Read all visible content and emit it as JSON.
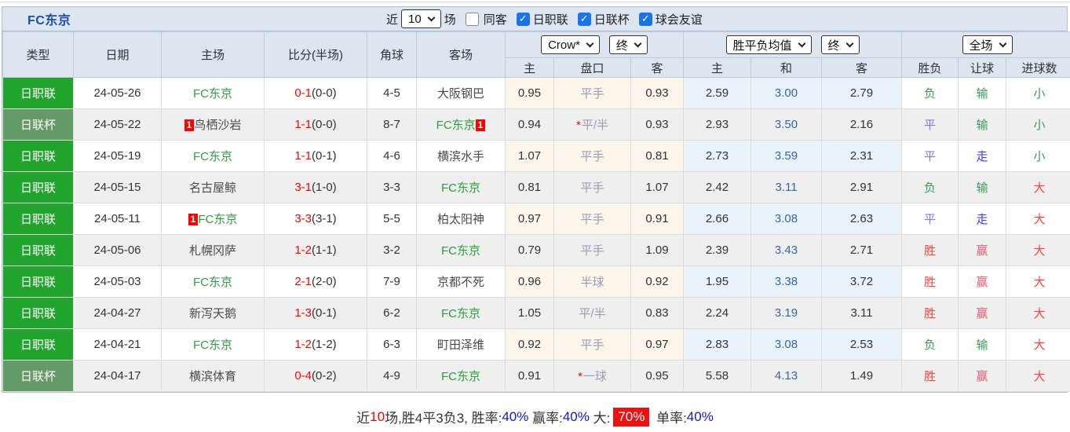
{
  "header": {
    "title": "FC东京"
  },
  "controls": {
    "recent_label": "近",
    "recent_value": "10",
    "matches_label": "场",
    "filters": [
      {
        "label": "同客",
        "checked": false
      },
      {
        "label": "日职联",
        "checked": true
      },
      {
        "label": "日联杯",
        "checked": true
      },
      {
        "label": "球会友谊",
        "checked": true
      }
    ]
  },
  "table": {
    "dropdowns": {
      "crow_company": "Crow*",
      "crow_period": "终",
      "avg_name": "胜平负均值",
      "avg_period": "终",
      "scope": "全场"
    },
    "columns": {
      "type": "类型",
      "date": "日期",
      "home": "主场",
      "score": "比分(半场)",
      "corner": "角球",
      "away": "客场",
      "sub": [
        "主",
        "盘口",
        "客",
        "主",
        "和",
        "客",
        "胜负",
        "让球",
        "进球数"
      ]
    },
    "rows": [
      {
        "league": "日职联",
        "league_type": "league",
        "date": "24-05-26",
        "home": {
          "name": "FC东京",
          "is_fc": true
        },
        "score_ft": "0-1",
        "score_ht": "0-0",
        "corner": "4-5",
        "away": {
          "name": "大阪钢巴",
          "is_fc": false
        },
        "crow_home": "0.95",
        "handicap": {
          "star": false,
          "text": "平手"
        },
        "crow_away": "0.93",
        "avg_home": "2.59",
        "avg_draw": "3.00",
        "avg_away": "2.79",
        "result": {
          "text": "负",
          "color": "green"
        },
        "handicap_result": {
          "text": "输",
          "color": "green"
        },
        "goals": {
          "text": "小",
          "color": "green"
        }
      },
      {
        "league": "日联杯",
        "league_type": "cup",
        "date": "24-05-22",
        "home": {
          "name": "鸟栖沙岩",
          "is_fc": false,
          "badge_before": "1"
        },
        "score_ft": "1-1",
        "score_ht": "0-0",
        "corner": "8-7",
        "away": {
          "name": "FC东京",
          "is_fc": true,
          "badge_after": "1"
        },
        "crow_home": "0.94",
        "handicap": {
          "star": true,
          "text": "平/半"
        },
        "crow_away": "0.93",
        "avg_home": "2.93",
        "avg_draw": "3.50",
        "avg_away": "2.16",
        "result": {
          "text": "平",
          "color": "blue"
        },
        "handicap_result": {
          "text": "输",
          "color": "green"
        },
        "goals": {
          "text": "小",
          "color": "green"
        }
      },
      {
        "league": "日职联",
        "league_type": "league",
        "date": "24-05-19",
        "home": {
          "name": "FC东京",
          "is_fc": true
        },
        "score_ft": "1-1",
        "score_ht": "0-1",
        "corner": "4-6",
        "away": {
          "name": "横滨水手",
          "is_fc": false
        },
        "crow_home": "1.07",
        "handicap": {
          "star": false,
          "text": "平手"
        },
        "crow_away": "0.81",
        "avg_home": "2.73",
        "avg_draw": "3.59",
        "avg_away": "2.31",
        "result": {
          "text": "平",
          "color": "blue"
        },
        "handicap_result": {
          "text": "走",
          "color": "blue2"
        },
        "goals": {
          "text": "小",
          "color": "green"
        }
      },
      {
        "league": "日职联",
        "league_type": "league",
        "date": "24-05-15",
        "home": {
          "name": "名古屋鲸",
          "is_fc": false
        },
        "score_ft": "3-1",
        "score_ht": "1-0",
        "corner": "3-3",
        "away": {
          "name": "FC东京",
          "is_fc": true
        },
        "crow_home": "0.81",
        "handicap": {
          "star": false,
          "text": "平手"
        },
        "crow_away": "1.07",
        "avg_home": "2.42",
        "avg_draw": "3.11",
        "avg_away": "2.91",
        "result": {
          "text": "负",
          "color": "green"
        },
        "handicap_result": {
          "text": "输",
          "color": "green"
        },
        "goals": {
          "text": "大",
          "color": "red"
        }
      },
      {
        "league": "日职联",
        "league_type": "league",
        "date": "24-05-11",
        "home": {
          "name": "FC东京",
          "is_fc": true,
          "badge_before": "1"
        },
        "score_ft": "3-3",
        "score_ht": "3-1",
        "corner": "5-5",
        "away": {
          "name": "柏太阳神",
          "is_fc": false
        },
        "crow_home": "0.97",
        "handicap": {
          "star": false,
          "text": "平手"
        },
        "crow_away": "0.91",
        "avg_home": "2.66",
        "avg_draw": "3.08",
        "avg_away": "2.63",
        "result": {
          "text": "平",
          "color": "blue"
        },
        "handicap_result": {
          "text": "走",
          "color": "blue2"
        },
        "goals": {
          "text": "大",
          "color": "red"
        }
      },
      {
        "league": "日职联",
        "league_type": "league",
        "date": "24-05-06",
        "home": {
          "name": "札幌冈萨",
          "is_fc": false
        },
        "score_ft": "1-2",
        "score_ht": "1-1",
        "corner": "3-2",
        "away": {
          "name": "FC东京",
          "is_fc": true
        },
        "crow_home": "0.79",
        "handicap": {
          "star": false,
          "text": "平手"
        },
        "crow_away": "1.09",
        "avg_home": "2.39",
        "avg_draw": "3.43",
        "avg_away": "2.71",
        "result": {
          "text": "胜",
          "color": "red"
        },
        "handicap_result": {
          "text": "赢",
          "color": "rose"
        },
        "goals": {
          "text": "大",
          "color": "red"
        }
      },
      {
        "league": "日职联",
        "league_type": "league",
        "date": "24-05-03",
        "home": {
          "name": "FC东京",
          "is_fc": true
        },
        "score_ft": "2-1",
        "score_ht": "2-0",
        "corner": "7-9",
        "away": {
          "name": "京都不死",
          "is_fc": false
        },
        "crow_home": "0.96",
        "handicap": {
          "star": false,
          "text": "半球"
        },
        "crow_away": "0.92",
        "avg_home": "1.95",
        "avg_draw": "3.38",
        "avg_away": "3.72",
        "result": {
          "text": "胜",
          "color": "red"
        },
        "handicap_result": {
          "text": "赢",
          "color": "rose"
        },
        "goals": {
          "text": "大",
          "color": "red"
        }
      },
      {
        "league": "日职联",
        "league_type": "league",
        "date": "24-04-27",
        "home": {
          "name": "新泻天鹅",
          "is_fc": false
        },
        "score_ft": "1-3",
        "score_ht": "0-1",
        "corner": "6-2",
        "away": {
          "name": "FC东京",
          "is_fc": true
        },
        "crow_home": "1.05",
        "handicap": {
          "star": false,
          "text": "平/半"
        },
        "crow_away": "0.83",
        "avg_home": "2.24",
        "avg_draw": "3.19",
        "avg_away": "3.11",
        "result": {
          "text": "胜",
          "color": "red"
        },
        "handicap_result": {
          "text": "赢",
          "color": "rose"
        },
        "goals": {
          "text": "大",
          "color": "red"
        }
      },
      {
        "league": "日职联",
        "league_type": "league",
        "date": "24-04-21",
        "home": {
          "name": "FC东京",
          "is_fc": true
        },
        "score_ft": "1-2",
        "score_ht": "1-2",
        "corner": "6-3",
        "away": {
          "name": "町田泽维",
          "is_fc": false
        },
        "crow_home": "0.92",
        "handicap": {
          "star": false,
          "text": "平手"
        },
        "crow_away": "0.97",
        "avg_home": "2.83",
        "avg_draw": "3.08",
        "avg_away": "2.53",
        "result": {
          "text": "负",
          "color": "green"
        },
        "handicap_result": {
          "text": "输",
          "color": "green"
        },
        "goals": {
          "text": "大",
          "color": "red"
        }
      },
      {
        "league": "日联杯",
        "league_type": "cup",
        "date": "24-04-17",
        "home": {
          "name": "横滨体育",
          "is_fc": false
        },
        "score_ft": "0-4",
        "score_ht": "0-2",
        "corner": "4-9",
        "away": {
          "name": "FC东京",
          "is_fc": true
        },
        "crow_home": "0.91",
        "handicap": {
          "star": true,
          "text": "一球"
        },
        "crow_away": "0.95",
        "avg_home": "5.58",
        "avg_draw": "4.13",
        "avg_away": "1.49",
        "result": {
          "text": "胜",
          "color": "red"
        },
        "handicap_result": {
          "text": "赢",
          "color": "rose"
        },
        "goals": {
          "text": "大",
          "color": "red"
        }
      }
    ]
  },
  "footer": {
    "segments": [
      {
        "text": "近",
        "style": "dark"
      },
      {
        "text": "10",
        "style": "red"
      },
      {
        "text": "场,胜4平3负3, 胜率:",
        "style": "dark"
      },
      {
        "text": "40%",
        "style": "blue"
      },
      {
        "text": " 赢率:",
        "style": "dark"
      },
      {
        "text": "40%",
        "style": "blue"
      },
      {
        "text": " 大:",
        "style": "dark"
      },
      {
        "text": "70%",
        "style": "badge"
      },
      {
        "text": " 单率:",
        "style": "dark"
      },
      {
        "text": "40%",
        "style": "blue"
      }
    ]
  },
  "colors": {
    "accent_checkbox_blue": "#1a73e8",
    "league_green": "#21a42e",
    "cup_green": "#649a68",
    "score_red": "#ff0000",
    "fc_team_green": "#2e9c3f",
    "avg_draw_blue": "#3465a4",
    "crow_cream_bg": "#fbf5ec",
    "avg_lightblue_bg": "#eaf3f9",
    "header_bg": "#dce5f0",
    "title_blue": "#1b4fa7"
  }
}
